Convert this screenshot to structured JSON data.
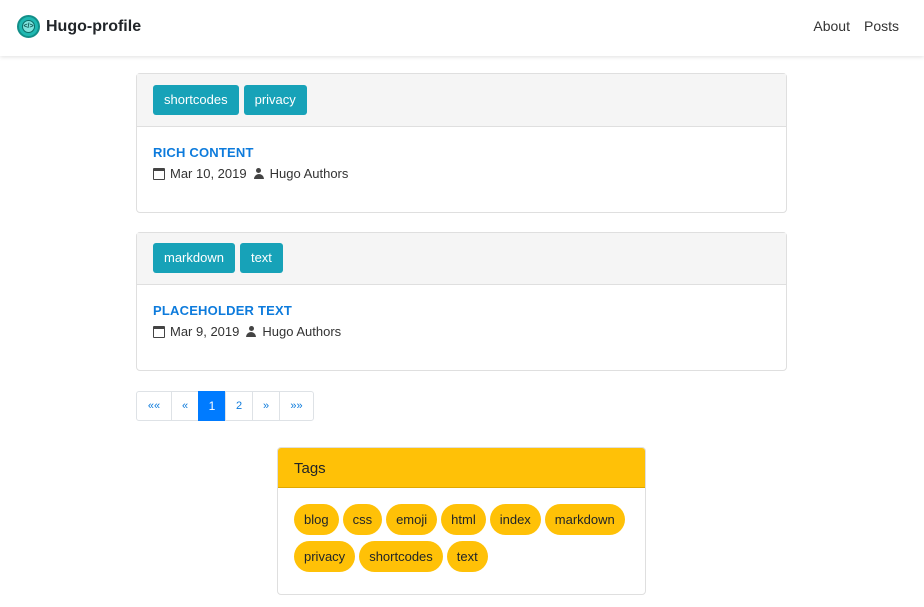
{
  "navbar": {
    "brand": "Hugo-profile",
    "links": [
      "About",
      "Posts"
    ]
  },
  "posts": [
    {
      "tags": [
        "shortcodes",
        "privacy"
      ],
      "title": "RICH CONTENT",
      "date": "Mar 10, 2019",
      "author": "Hugo Authors"
    },
    {
      "tags": [
        "markdown",
        "text"
      ],
      "title": "PLACEHOLDER TEXT",
      "date": "Mar 9, 2019",
      "author": "Hugo Authors"
    }
  ],
  "pagination": [
    "««",
    "«",
    "1",
    "2",
    "»",
    "»»"
  ],
  "current_page": "1",
  "tags_widget": {
    "title": "Tags",
    "tags": [
      "blog",
      "css",
      "emoji",
      "html",
      "index",
      "markdown",
      "privacy",
      "shortcodes",
      "text"
    ]
  },
  "colors": {
    "accent_tag": "#17a2b8",
    "link": "#0d7bdc",
    "pill": "#ffc107",
    "active_page": "#007bff"
  }
}
